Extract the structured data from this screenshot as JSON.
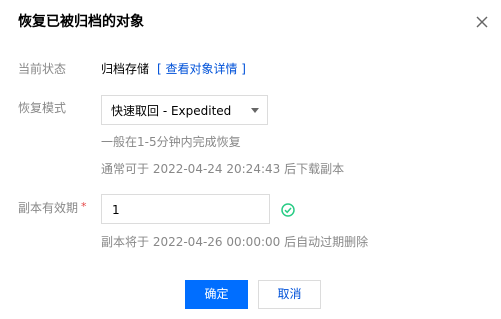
{
  "dialog": {
    "title": "恢复已被归档的对象",
    "close_icon": "close-icon"
  },
  "status": {
    "label": "当前状态",
    "value": "归档存储",
    "link": "[ 查看对象详情 ]"
  },
  "mode": {
    "label": "恢复模式",
    "selected": "快速取回 - Expedited",
    "hint1": "一般在1-5分钟内完成恢复",
    "hint2": "通常可于 2022-04-24 20:24:43 后下载副本"
  },
  "validity": {
    "label": "副本有效期",
    "required_mark": "*",
    "value": "1",
    "valid_icon": "check-circle-icon",
    "hint": "副本将于 2022-04-26 00:00:00 后自动过期删除"
  },
  "buttons": {
    "confirm": "确定",
    "cancel": "取消"
  },
  "colors": {
    "primary": "#006eff",
    "link": "#0052d9",
    "success": "#29cc85",
    "required": "#e54545"
  }
}
